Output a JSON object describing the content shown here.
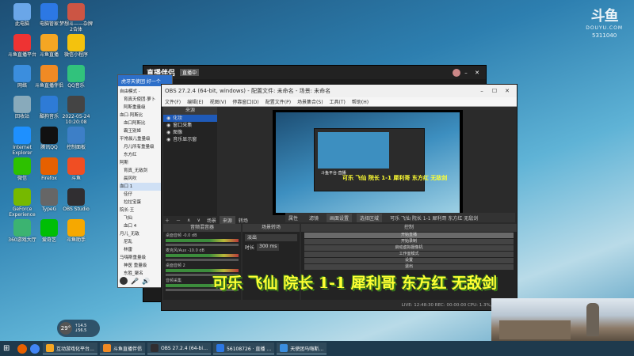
{
  "watermark": {
    "logo": "斗鱼",
    "sub": "DOUYU.COM",
    "room_id": "5311040"
  },
  "desktop_icons": [
    {
      "label": "此电脑",
      "color": "#6aa6e8"
    },
    {
      "label": "电脑管家",
      "color": "#2c78e4"
    },
    {
      "label": "梦想斗——杂牌2合体",
      "color": "#c54"
    },
    {
      "label": "斗鱼直播平台",
      "color": "#e33"
    },
    {
      "label": "斗鱼直播",
      "color": "#f5a623"
    },
    {
      "label": "微信小程序",
      "color": "#f4c20d"
    },
    {
      "label": "网络",
      "color": "#3b8ede"
    },
    {
      "label": "斗鱼直播伴侣",
      "color": "#f08a24"
    },
    {
      "label": "QQ音乐",
      "color": "#31c27c"
    },
    {
      "label": "回收站",
      "color": "#8ab"
    },
    {
      "label": "酷狗音乐",
      "color": "#2e7bd6"
    },
    {
      "label": "2022-05-24 10:20:08",
      "color": "#444"
    },
    {
      "label": "Internet Explorer",
      "color": "#1e90ff"
    },
    {
      "label": "腾讯QQ",
      "color": "#111"
    },
    {
      "label": "控制面板",
      "color": "#3d7fc7"
    },
    {
      "label": "微信",
      "color": "#2dc100"
    },
    {
      "label": "Firefox",
      "color": "#e66000"
    },
    {
      "label": "斗鱼",
      "color": "#f04e23"
    },
    {
      "label": "GeForce Experience",
      "color": "#76b900"
    },
    {
      "label": "TypeG",
      "color": "#666"
    },
    {
      "label": "OBS Studio",
      "color": "#302e31"
    },
    {
      "label": "360游戏大厅",
      "color": "#3cb371"
    },
    {
      "label": "爱奇艺",
      "color": "#00be06"
    },
    {
      "label": "斗鱼助手",
      "color": "#f6a800"
    }
  ],
  "douyu_window": {
    "title": "直播伴侣",
    "badge": "直播中",
    "menu_user": "直播伴侣"
  },
  "left_panel": {
    "title": "虎牙天使团 好一个",
    "items": [
      "自由模式 - ",
      "育真天使团·萝卜",
      "阿斯重量级",
      "血口·阿斯比",
      "血口阿斯比",
      "霸王别姬",
      "平常晨儿重量级",
      "月儿所有重量级",
      "东方红",
      "阿斯",
      "育真_无敌剑",
      "晨风吹",
      "血口 1",
      "佳仔",
      "拉拉宝蛋",
      "院长·王",
      "飞仙",
      "血口 4",
      "月儿_无敌",
      "尼乱",
      "林雷",
      "马嗨斯重量级",
      "神医 重量级",
      "东胜_聚名"
    ]
  },
  "obs": {
    "title": "OBS 27.2.4 (64-bit, windows) - 配置文件: 未命名 - 场景: 未命名",
    "menu": [
      "文件(F)",
      "编辑(E)",
      "视图(V)",
      "停靠窗口(D)",
      "配置文件(P)",
      "场景集合(S)",
      "工具(T)",
      "帮助(H)"
    ],
    "scene_header": "来源",
    "sources": [
      "化妆",
      "窗口采集",
      "图像",
      "音乐显示窗"
    ],
    "tabs": [
      "场景",
      "来源",
      "转场"
    ],
    "toolbar_items": [
      "属性",
      "滤镜",
      "画面设置",
      "选择区域"
    ],
    "track_text": "可乐 飞仙 院长 1-1 犀利哥 东方红 无敌剑",
    "mixer_header": "音频混音器",
    "mixer_tracks": [
      "桌面音频 -0.0 dB",
      "麦克风/Aux -10.0 dB",
      "桌面音频 2",
      "音频采集"
    ],
    "transition_header": "场景转场",
    "transition_type": "淡出",
    "duration_label": "时长",
    "duration_value": "300 ms",
    "controls_header": "控制",
    "controls": [
      "开始直播",
      "开始录制",
      "启动虚拟摄像机",
      "工作室模式",
      "设置",
      "退出"
    ],
    "status": "LIVE: 12:48:30  REC: 00:00:00  CPU: 1.3%, 60.00 fps"
  },
  "overlay_text": "可乐 飞仙 院长 1-1 犀利哥 东方红 无敌剑",
  "weather": {
    "temp": "29",
    "unit": "°",
    "up": "14.5",
    "down": "56.5"
  },
  "taskbar": {
    "items": [
      {
        "label": "互动游戏化平台…",
        "color": "#f5a623"
      },
      {
        "label": "斗鱼直播伴侣",
        "color": "#f08a24"
      },
      {
        "label": "OBS 27.2.4 (64-bi…",
        "color": "#302e31"
      },
      {
        "label": "56108726 · 直播 …",
        "color": "#2c78e4"
      },
      {
        "label": "天使团马嗨斯…",
        "color": "#3b8ede"
      }
    ]
  }
}
